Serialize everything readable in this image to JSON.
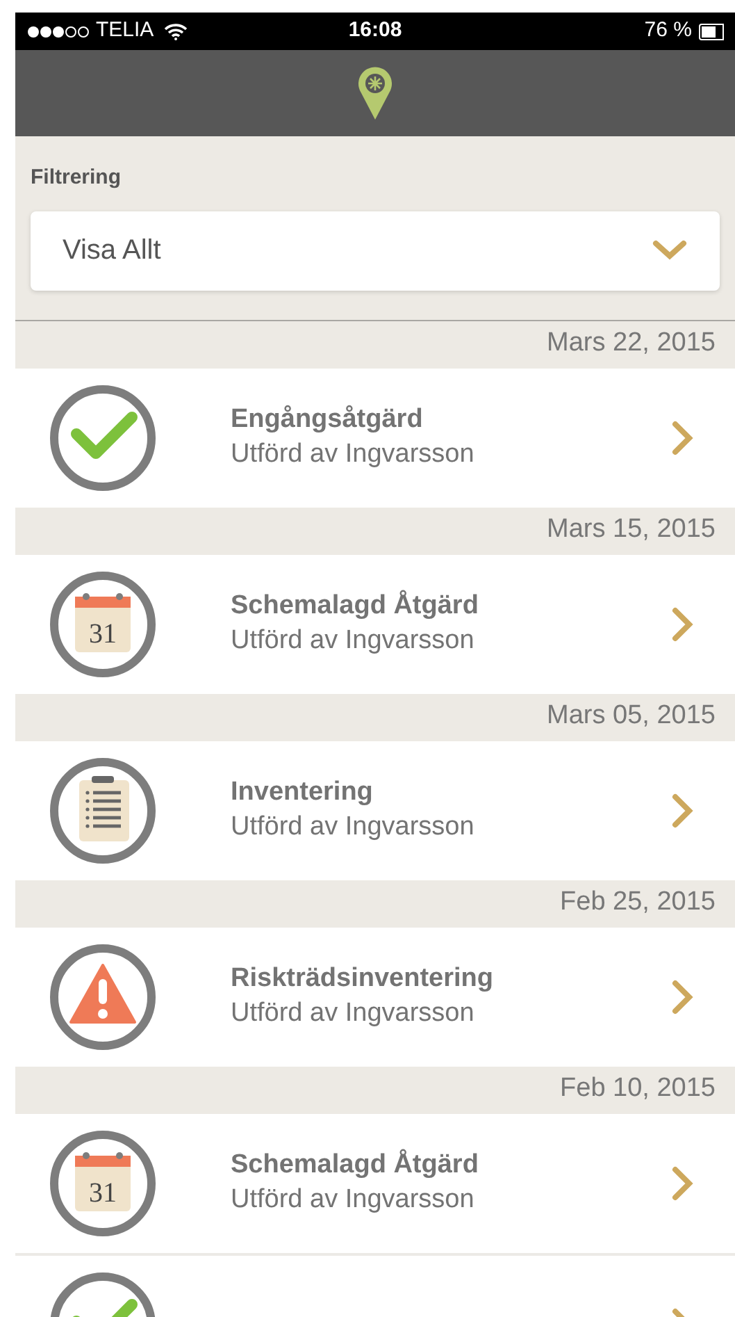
{
  "status_bar": {
    "carrier": "TELIA",
    "time": "16:08",
    "battery": "76 %"
  },
  "filter": {
    "label": "Filtrering",
    "value": "Visa Allt"
  },
  "sections": [
    {
      "date": "Mars 22, 2015",
      "items": [
        {
          "kind": "check",
          "title": "Engångsåtgärd",
          "subtitle": "Utförd av Ingvarsson"
        }
      ]
    },
    {
      "date": "Mars 15, 2015",
      "items": [
        {
          "kind": "calendar",
          "icon_text": "31",
          "title": "Schemalagd Åtgärd",
          "subtitle": "Utförd av Ingvarsson"
        }
      ]
    },
    {
      "date": "Mars 05, 2015",
      "items": [
        {
          "kind": "clipboard",
          "title": "Inventering",
          "subtitle": "Utförd av Ingvarsson"
        }
      ]
    },
    {
      "date": "Feb 25, 2015",
      "items": [
        {
          "kind": "warning",
          "title": "Riskträdsinventering",
          "subtitle": "Utförd av Ingvarsson"
        }
      ]
    },
    {
      "date": "Feb 10, 2015",
      "items": [
        {
          "kind": "calendar",
          "icon_text": "31",
          "title": "Schemalagd Åtgärd",
          "subtitle": "Utförd av Ingvarsson"
        },
        {
          "kind": "check"
        }
      ]
    }
  ]
}
